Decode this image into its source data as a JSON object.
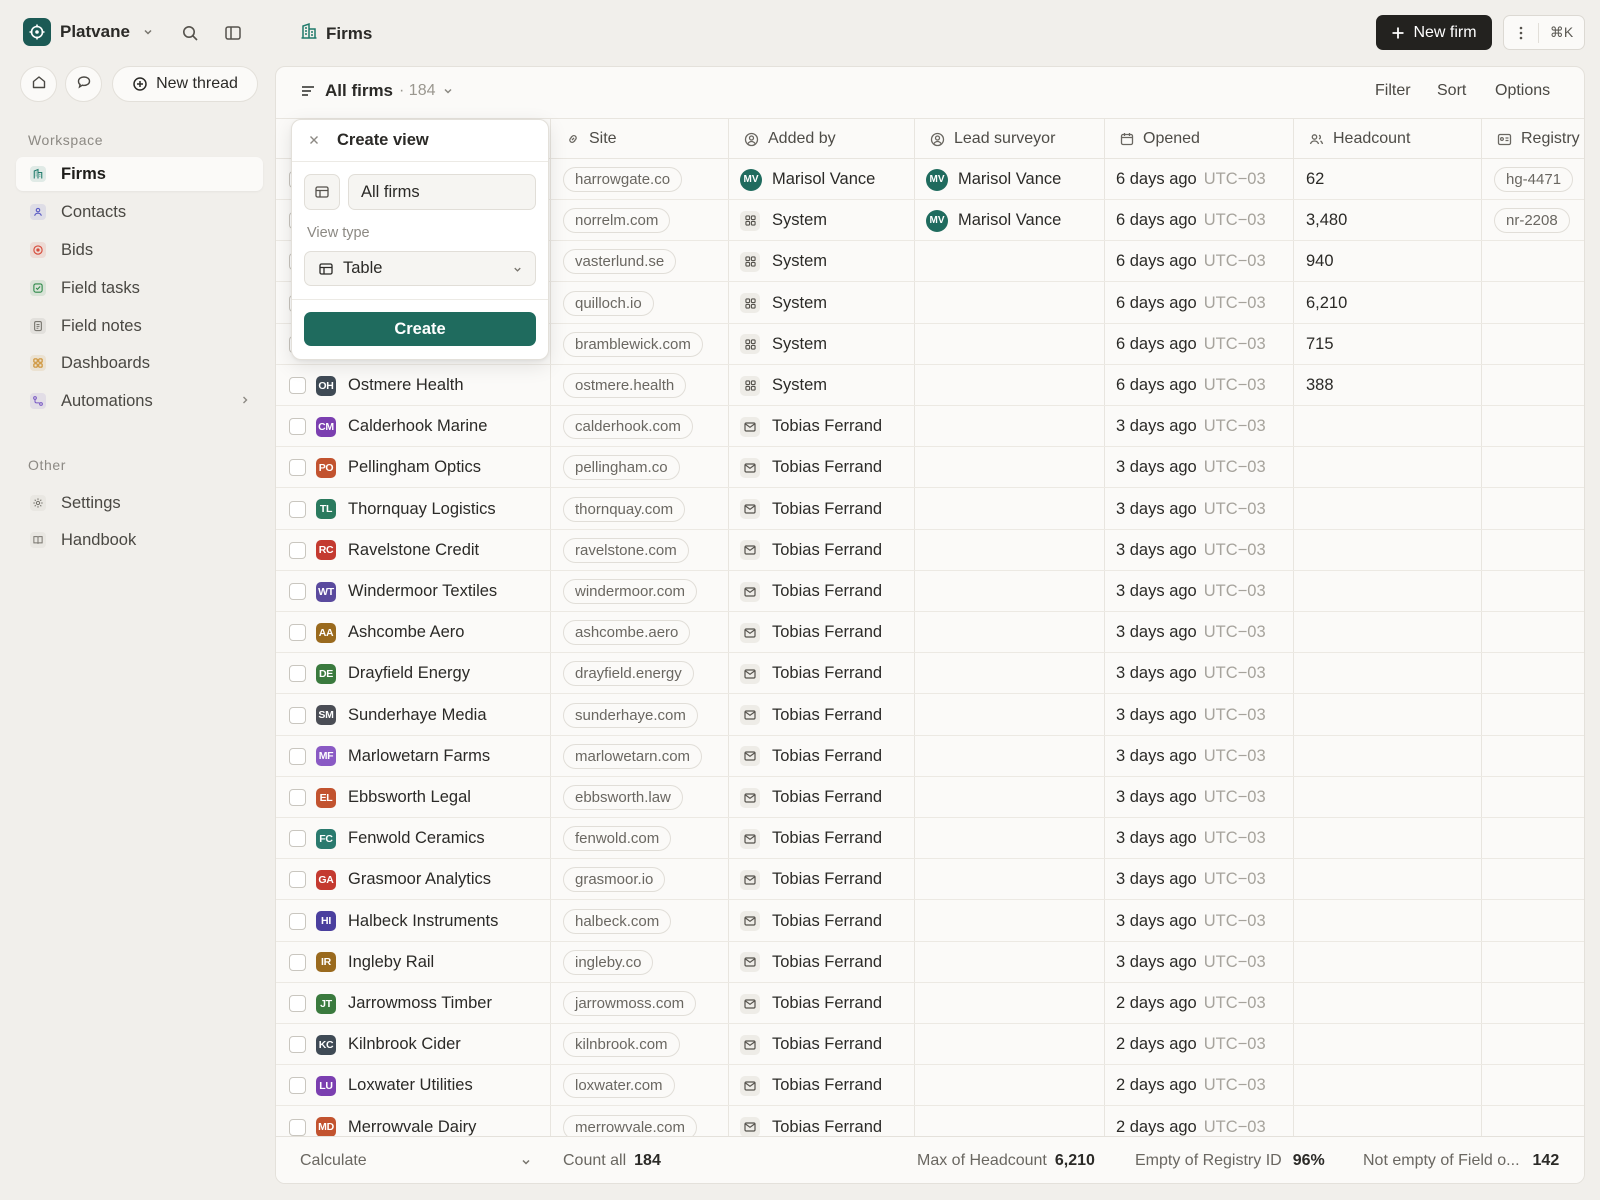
{
  "app": {
    "name": "Platvane",
    "page_title": "Firms"
  },
  "top": {
    "new_firm_label": "New firm",
    "shortcut": "⌘K",
    "new_thread_label": "New thread"
  },
  "sidebar": {
    "workspace_label": "Workspace",
    "other_label": "Other",
    "items": [
      {
        "label": "Firms",
        "icon": "building-icon",
        "color": "#1f7a6b"
      },
      {
        "label": "Contacts",
        "icon": "person-icon",
        "color": "#5a5bc4"
      },
      {
        "label": "Bids",
        "icon": "target-icon",
        "color": "#d64b3b"
      },
      {
        "label": "Field tasks",
        "icon": "check-square-icon",
        "color": "#2f8a4a"
      },
      {
        "label": "Field notes",
        "icon": "note-icon",
        "color": "#7a7770"
      },
      {
        "label": "Dashboards",
        "icon": "grid-icon",
        "color": "#c9861e"
      },
      {
        "label": "Automations",
        "icon": "flow-icon",
        "color": "#7a5ac4"
      }
    ],
    "other_items": [
      {
        "label": "Settings",
        "icon": "gear-icon"
      },
      {
        "label": "Handbook",
        "icon": "book-icon"
      }
    ]
  },
  "view": {
    "name": "All firms",
    "count": "· 184",
    "filter": "Filter",
    "sort": "Sort",
    "options": "Options"
  },
  "columns": {
    "site": "Site",
    "added_by": "Added by",
    "lead": "Lead surveyor",
    "opened": "Opened",
    "headcount": "Headcount",
    "registry": "Registry"
  },
  "rows": [
    {
      "initials": "",
      "name": "",
      "color": "#1f6b5e",
      "site": "harrowgate.co",
      "added_by": "Marisol Vance",
      "added_type": "user",
      "added_initials": "MV",
      "lead": "Marisol Vance",
      "lead_initials": "MV",
      "opened": "6 days ago",
      "tz": "UTC−03",
      "headcount": "62",
      "registry": "hg-4471"
    },
    {
      "initials": "",
      "name": "",
      "color": "#1f6b5e",
      "site": "norrelm.com",
      "added_by": "System",
      "added_type": "system",
      "added_initials": "",
      "lead": "Marisol Vance",
      "lead_initials": "MV",
      "opened": "6 days ago",
      "tz": "UTC−03",
      "headcount": "3,480",
      "registry": "nr-2208"
    },
    {
      "initials": "",
      "name": "",
      "color": "#1f6b5e",
      "site": "vasterlund.se",
      "added_by": "System",
      "added_type": "system",
      "added_initials": "",
      "lead": "",
      "lead_initials": "",
      "opened": "6 days ago",
      "tz": "UTC−03",
      "headcount": "940",
      "registry": ""
    },
    {
      "initials": "",
      "name": "",
      "color": "#1f6b5e",
      "site": "quilloch.io",
      "added_by": "System",
      "added_type": "system",
      "added_initials": "",
      "lead": "",
      "lead_initials": "",
      "opened": "6 days ago",
      "tz": "UTC−03",
      "headcount": "6,210",
      "registry": ""
    },
    {
      "initials": "",
      "name": "",
      "color": "#1f6b5e",
      "site": "bramblewick.com",
      "added_by": "System",
      "added_type": "system",
      "added_initials": "",
      "lead": "",
      "lead_initials": "",
      "opened": "6 days ago",
      "tz": "UTC−03",
      "headcount": "715",
      "registry": ""
    },
    {
      "initials": "OH",
      "name": "Ostmere Health",
      "color": "#3f4a55",
      "site": "ostmere.health",
      "added_by": "System",
      "added_type": "system",
      "added_initials": "",
      "lead": "",
      "lead_initials": "",
      "opened": "6 days ago",
      "tz": "UTC−03",
      "headcount": "388",
      "registry": ""
    },
    {
      "initials": "CM",
      "name": "Calderhook Marine",
      "color": "#7b3fb0",
      "site": "calderhook.com",
      "added_by": "Tobias Ferrand",
      "added_type": "mail",
      "added_initials": "",
      "lead": "",
      "lead_initials": "",
      "opened": "3 days ago",
      "tz": "UTC−03",
      "headcount": "",
      "registry": ""
    },
    {
      "initials": "PO",
      "name": "Pellingham Optics",
      "color": "#c2532f",
      "site": "pellingham.co",
      "added_by": "Tobias Ferrand",
      "added_type": "mail",
      "added_initials": "",
      "lead": "",
      "lead_initials": "",
      "opened": "3 days ago",
      "tz": "UTC−03",
      "headcount": "",
      "registry": ""
    },
    {
      "initials": "TL",
      "name": "Thornquay Logistics",
      "color": "#2a7a5e",
      "site": "thornquay.com",
      "added_by": "Tobias Ferrand",
      "added_type": "mail",
      "added_initials": "",
      "lead": "",
      "lead_initials": "",
      "opened": "3 days ago",
      "tz": "UTC−03",
      "headcount": "",
      "registry": ""
    },
    {
      "initials": "RC",
      "name": "Ravelstone Credit",
      "color": "#c43a30",
      "site": "ravelstone.com",
      "added_by": "Tobias Ferrand",
      "added_type": "mail",
      "added_initials": "",
      "lead": "",
      "lead_initials": "",
      "opened": "3 days ago",
      "tz": "UTC−03",
      "headcount": "",
      "registry": ""
    },
    {
      "initials": "WT",
      "name": "Windermoor Textiles",
      "color": "#5a4a9e",
      "site": "windermoor.com",
      "added_by": "Tobias Ferrand",
      "added_type": "mail",
      "added_initials": "",
      "lead": "",
      "lead_initials": "",
      "opened": "3 days ago",
      "tz": "UTC−03",
      "headcount": "",
      "registry": ""
    },
    {
      "initials": "AA",
      "name": "Ashcombe Aero",
      "color": "#9a6a1e",
      "site": "ashcombe.aero",
      "added_by": "Tobias Ferrand",
      "added_type": "mail",
      "added_initials": "",
      "lead": "",
      "lead_initials": "",
      "opened": "3 days ago",
      "tz": "UTC−03",
      "headcount": "",
      "registry": ""
    },
    {
      "initials": "DE",
      "name": "Drayfield Energy",
      "color": "#3a7a3e",
      "site": "drayfield.energy",
      "added_by": "Tobias Ferrand",
      "added_type": "mail",
      "added_initials": "",
      "lead": "",
      "lead_initials": "",
      "opened": "3 days ago",
      "tz": "UTC−03",
      "headcount": "",
      "registry": ""
    },
    {
      "initials": "SM",
      "name": "Sunderhaye Media",
      "color": "#4a4d55",
      "site": "sunderhaye.com",
      "added_by": "Tobias Ferrand",
      "added_type": "mail",
      "added_initials": "",
      "lead": "",
      "lead_initials": "",
      "opened": "3 days ago",
      "tz": "UTC−03",
      "headcount": "",
      "registry": ""
    },
    {
      "initials": "MF",
      "name": "Marlowetarn Farms",
      "color": "#8a5ac4",
      "site": "marlowetarn.com",
      "added_by": "Tobias Ferrand",
      "added_type": "mail",
      "added_initials": "",
      "lead": "",
      "lead_initials": "",
      "opened": "3 days ago",
      "tz": "UTC−03",
      "headcount": "",
      "registry": ""
    },
    {
      "initials": "EL",
      "name": "Ebbsworth Legal",
      "color": "#c2532f",
      "site": "ebbsworth.law",
      "added_by": "Tobias Ferrand",
      "added_type": "mail",
      "added_initials": "",
      "lead": "",
      "lead_initials": "",
      "opened": "3 days ago",
      "tz": "UTC−03",
      "headcount": "",
      "registry": ""
    },
    {
      "initials": "FC",
      "name": "Fenwold Ceramics",
      "color": "#2a7a6e",
      "site": "fenwold.com",
      "added_by": "Tobias Ferrand",
      "added_type": "mail",
      "added_initials": "",
      "lead": "",
      "lead_initials": "",
      "opened": "3 days ago",
      "tz": "UTC−03",
      "headcount": "",
      "registry": ""
    },
    {
      "initials": "GA",
      "name": "Grasmoor Analytics",
      "color": "#c43a30",
      "site": "grasmoor.io",
      "added_by": "Tobias Ferrand",
      "added_type": "mail",
      "added_initials": "",
      "lead": "",
      "lead_initials": "",
      "opened": "3 days ago",
      "tz": "UTC−03",
      "headcount": "",
      "registry": ""
    },
    {
      "initials": "HI",
      "name": "Halbeck Instruments",
      "color": "#4a3f9e",
      "site": "halbeck.com",
      "added_by": "Tobias Ferrand",
      "added_type": "mail",
      "added_initials": "",
      "lead": "",
      "lead_initials": "",
      "opened": "3 days ago",
      "tz": "UTC−03",
      "headcount": "",
      "registry": ""
    },
    {
      "initials": "IR",
      "name": "Ingleby Rail",
      "color": "#9a6a1e",
      "site": "ingleby.co",
      "added_by": "Tobias Ferrand",
      "added_type": "mail",
      "added_initials": "",
      "lead": "",
      "lead_initials": "",
      "opened": "3 days ago",
      "tz": "UTC−03",
      "headcount": "",
      "registry": ""
    },
    {
      "initials": "JT",
      "name": "Jarrowmoss Timber",
      "color": "#3a7a3e",
      "site": "jarrowmoss.com",
      "added_by": "Tobias Ferrand",
      "added_type": "mail",
      "added_initials": "",
      "lead": "",
      "lead_initials": "",
      "opened": "2 days ago",
      "tz": "UTC−03",
      "headcount": "",
      "registry": ""
    },
    {
      "initials": "KC",
      "name": "Kilnbrook Cider",
      "color": "#3f4a55",
      "site": "kilnbrook.com",
      "added_by": "Tobias Ferrand",
      "added_type": "mail",
      "added_initials": "",
      "lead": "",
      "lead_initials": "",
      "opened": "2 days ago",
      "tz": "UTC−03",
      "headcount": "",
      "registry": ""
    },
    {
      "initials": "LU",
      "name": "Loxwater Utilities",
      "color": "#7b3fb0",
      "site": "loxwater.com",
      "added_by": "Tobias Ferrand",
      "added_type": "mail",
      "added_initials": "",
      "lead": "",
      "lead_initials": "",
      "opened": "2 days ago",
      "tz": "UTC−03",
      "headcount": "",
      "registry": ""
    },
    {
      "initials": "MD",
      "name": "Merrowvale Dairy",
      "color": "#c2532f",
      "site": "merrowvale.com",
      "added_by": "Tobias Ferrand",
      "added_type": "mail",
      "added_initials": "",
      "lead": "",
      "lead_initials": "",
      "opened": "2 days ago",
      "tz": "UTC−03",
      "headcount": "",
      "registry": ""
    }
  ],
  "footer": {
    "calculate": "Calculate",
    "count_label": "Count all",
    "count_value": "184",
    "max_label": "Max of Headcount",
    "max_value": "6,210",
    "empty_label": "Empty of Registry ID",
    "empty_value": "96%",
    "notempty_label": "Not empty of Field o...",
    "notempty_value": "142"
  },
  "popover": {
    "title": "Create view",
    "name_value": "All firms",
    "view_type_label": "View type",
    "view_type_value": "Table",
    "create_label": "Create"
  }
}
